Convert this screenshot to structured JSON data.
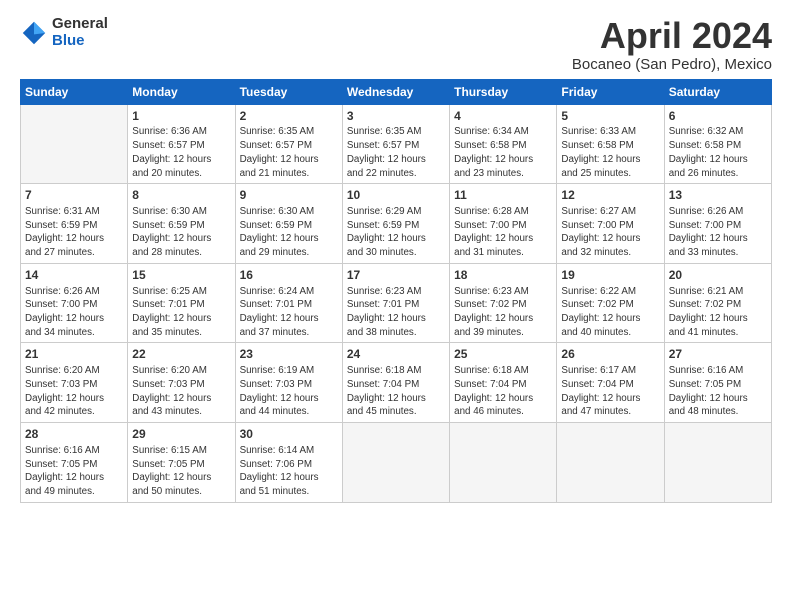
{
  "logo": {
    "general": "General",
    "blue": "Blue"
  },
  "title": "April 2024",
  "location": "Bocaneo (San Pedro), Mexico",
  "days_header": [
    "Sunday",
    "Monday",
    "Tuesday",
    "Wednesday",
    "Thursday",
    "Friday",
    "Saturday"
  ],
  "weeks": [
    [
      {
        "day": "",
        "info": ""
      },
      {
        "day": "1",
        "info": "Sunrise: 6:36 AM\nSunset: 6:57 PM\nDaylight: 12 hours\nand 20 minutes."
      },
      {
        "day": "2",
        "info": "Sunrise: 6:35 AM\nSunset: 6:57 PM\nDaylight: 12 hours\nand 21 minutes."
      },
      {
        "day": "3",
        "info": "Sunrise: 6:35 AM\nSunset: 6:57 PM\nDaylight: 12 hours\nand 22 minutes."
      },
      {
        "day": "4",
        "info": "Sunrise: 6:34 AM\nSunset: 6:58 PM\nDaylight: 12 hours\nand 23 minutes."
      },
      {
        "day": "5",
        "info": "Sunrise: 6:33 AM\nSunset: 6:58 PM\nDaylight: 12 hours\nand 25 minutes."
      },
      {
        "day": "6",
        "info": "Sunrise: 6:32 AM\nSunset: 6:58 PM\nDaylight: 12 hours\nand 26 minutes."
      }
    ],
    [
      {
        "day": "7",
        "info": "Sunrise: 6:31 AM\nSunset: 6:59 PM\nDaylight: 12 hours\nand 27 minutes."
      },
      {
        "day": "8",
        "info": "Sunrise: 6:30 AM\nSunset: 6:59 PM\nDaylight: 12 hours\nand 28 minutes."
      },
      {
        "day": "9",
        "info": "Sunrise: 6:30 AM\nSunset: 6:59 PM\nDaylight: 12 hours\nand 29 minutes."
      },
      {
        "day": "10",
        "info": "Sunrise: 6:29 AM\nSunset: 6:59 PM\nDaylight: 12 hours\nand 30 minutes."
      },
      {
        "day": "11",
        "info": "Sunrise: 6:28 AM\nSunset: 7:00 PM\nDaylight: 12 hours\nand 31 minutes."
      },
      {
        "day": "12",
        "info": "Sunrise: 6:27 AM\nSunset: 7:00 PM\nDaylight: 12 hours\nand 32 minutes."
      },
      {
        "day": "13",
        "info": "Sunrise: 6:26 AM\nSunset: 7:00 PM\nDaylight: 12 hours\nand 33 minutes."
      }
    ],
    [
      {
        "day": "14",
        "info": "Sunrise: 6:26 AM\nSunset: 7:00 PM\nDaylight: 12 hours\nand 34 minutes."
      },
      {
        "day": "15",
        "info": "Sunrise: 6:25 AM\nSunset: 7:01 PM\nDaylight: 12 hours\nand 35 minutes."
      },
      {
        "day": "16",
        "info": "Sunrise: 6:24 AM\nSunset: 7:01 PM\nDaylight: 12 hours\nand 37 minutes."
      },
      {
        "day": "17",
        "info": "Sunrise: 6:23 AM\nSunset: 7:01 PM\nDaylight: 12 hours\nand 38 minutes."
      },
      {
        "day": "18",
        "info": "Sunrise: 6:23 AM\nSunset: 7:02 PM\nDaylight: 12 hours\nand 39 minutes."
      },
      {
        "day": "19",
        "info": "Sunrise: 6:22 AM\nSunset: 7:02 PM\nDaylight: 12 hours\nand 40 minutes."
      },
      {
        "day": "20",
        "info": "Sunrise: 6:21 AM\nSunset: 7:02 PM\nDaylight: 12 hours\nand 41 minutes."
      }
    ],
    [
      {
        "day": "21",
        "info": "Sunrise: 6:20 AM\nSunset: 7:03 PM\nDaylight: 12 hours\nand 42 minutes."
      },
      {
        "day": "22",
        "info": "Sunrise: 6:20 AM\nSunset: 7:03 PM\nDaylight: 12 hours\nand 43 minutes."
      },
      {
        "day": "23",
        "info": "Sunrise: 6:19 AM\nSunset: 7:03 PM\nDaylight: 12 hours\nand 44 minutes."
      },
      {
        "day": "24",
        "info": "Sunrise: 6:18 AM\nSunset: 7:04 PM\nDaylight: 12 hours\nand 45 minutes."
      },
      {
        "day": "25",
        "info": "Sunrise: 6:18 AM\nSunset: 7:04 PM\nDaylight: 12 hours\nand 46 minutes."
      },
      {
        "day": "26",
        "info": "Sunrise: 6:17 AM\nSunset: 7:04 PM\nDaylight: 12 hours\nand 47 minutes."
      },
      {
        "day": "27",
        "info": "Sunrise: 6:16 AM\nSunset: 7:05 PM\nDaylight: 12 hours\nand 48 minutes."
      }
    ],
    [
      {
        "day": "28",
        "info": "Sunrise: 6:16 AM\nSunset: 7:05 PM\nDaylight: 12 hours\nand 49 minutes."
      },
      {
        "day": "29",
        "info": "Sunrise: 6:15 AM\nSunset: 7:05 PM\nDaylight: 12 hours\nand 50 minutes."
      },
      {
        "day": "30",
        "info": "Sunrise: 6:14 AM\nSunset: 7:06 PM\nDaylight: 12 hours\nand 51 minutes."
      },
      {
        "day": "",
        "info": ""
      },
      {
        "day": "",
        "info": ""
      },
      {
        "day": "",
        "info": ""
      },
      {
        "day": "",
        "info": ""
      }
    ]
  ]
}
